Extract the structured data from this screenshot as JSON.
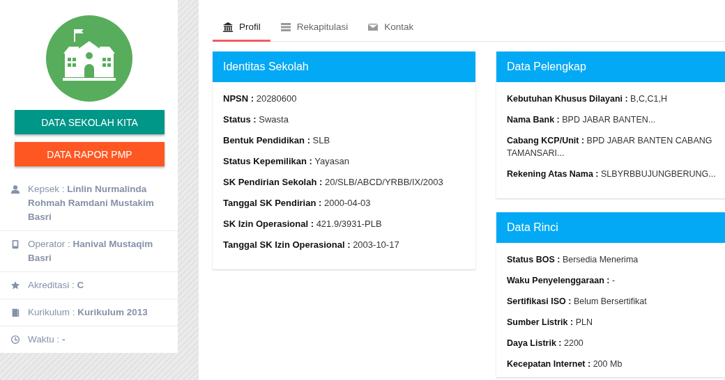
{
  "sidebar": {
    "buttons": [
      {
        "label": "DATA SEKOLAH KITA",
        "kind": "primary"
      },
      {
        "label": "DATA RAPOR PMP",
        "kind": "accent"
      }
    ],
    "info": [
      {
        "text": "Kepsek : **Linlin Nurmalinda Rohmah Ramdani Mustakim Basri**"
      },
      {
        "text": "Operator : **Hanival Mustaqim Basri**"
      },
      {
        "text": "Akreditasi : **C**"
      },
      {
        "text": "Kurikulum : **Kurikulum 2013**"
      },
      {
        "text": "Waktu : **-**"
      }
    ]
  },
  "tabs": [
    {
      "label": "Profil",
      "selected": true
    },
    {
      "label": "Rekapitulasi",
      "selected": false
    },
    {
      "label": "Kontak",
      "selected": false
    }
  ],
  "left_cards": [
    {
      "title": "Identitas Sekolah",
      "fields": [
        "**NPSN :** 20280600",
        "**Status :** Swasta",
        "**Bentuk Pendidikan :** SLB",
        "**Status Kepemilikan :** Yayasan",
        "**SK Pendirian Sekolah :** 20/SLB/ABCD/YRBB/IX/2003",
        "**Tanggal SK Pendirian :** 2000-04-03",
        "**SK Izin Operasional :** 421.9/3931-PLB",
        "**Tanggal SK Izin Operasional :** 2003-10-17"
      ]
    }
  ],
  "right_cards": [
    {
      "title": "Data Pelengkap",
      "fields": [
        "**Kebutuhan Khusus Dilayani :** B,C,C1,H",
        "**Nama Bank :** BPD JABAR BANTEN...",
        "**Cabang KCP/Unit :** BPD JABAR BANTEN CABANG TAMANSARI...",
        "**Rekening Atas Nama :** SLBYRBBUJUNGBERUNG..."
      ]
    },
    {
      "title": "Data Rinci",
      "fields": [
        "**Status BOS :** Bersedia Menerima",
        "**Waku Penyelenggaraan :** -",
        "**Sertifikasi ISO :** Belum Bersertifikat",
        "**Sumber Listrik :** PLN",
        "**Daya Listrik :** 2200",
        "**Kecepatan Internet :** 200 Mb"
      ]
    }
  ]
}
